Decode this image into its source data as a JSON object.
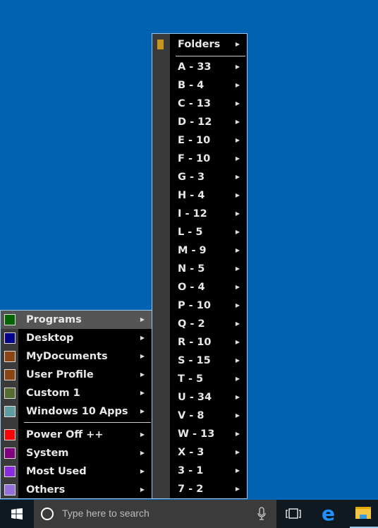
{
  "left_menu": {
    "items": [
      {
        "label": "Programs",
        "color": "#006400",
        "highlighted": true
      },
      {
        "label": "Desktop",
        "color": "#00008b"
      },
      {
        "label": "MyDocuments",
        "color": "#8b4513"
      },
      {
        "label": "User Profile",
        "color": "#8b4513"
      },
      {
        "label": "Custom 1",
        "color": "#556b2f"
      },
      {
        "label": "Windows 10 Apps",
        "color": "#5f9ea0"
      },
      {
        "label": "Power Off ++",
        "color": "#ff0000"
      },
      {
        "label": "System",
        "color": "#800080"
      },
      {
        "label": "Most Used",
        "color": "#8a2be2"
      },
      {
        "label": "Others",
        "color": "#9370db"
      }
    ]
  },
  "right_menu": {
    "header": "Folders",
    "items": [
      "A - 33",
      "B - 4",
      "C - 13",
      "D - 12",
      "E - 10",
      "F - 10",
      "G - 3",
      "H - 4",
      "I - 12",
      "L - 5",
      "M - 9",
      "N - 5",
      "O - 4",
      "P - 10",
      "Q - 2",
      "R - 10",
      "S - 15",
      "T - 5",
      "U - 34",
      "V - 8",
      "W - 13",
      "X - 3",
      "3 - 1",
      "7 - 2"
    ]
  },
  "taskbar": {
    "search_placeholder": "Type here to search"
  }
}
